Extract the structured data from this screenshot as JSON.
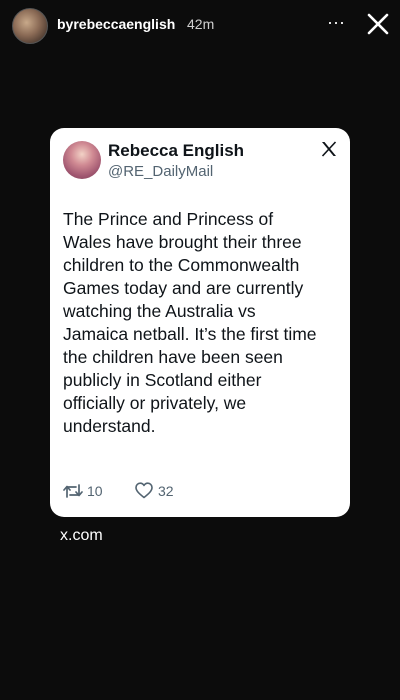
{
  "story": {
    "username": "byrebeccaenglish",
    "time": "42m",
    "more_icon": "more-horizontal-icon",
    "close_icon": "close-icon"
  },
  "tweet": {
    "author_name": "Rebecca English",
    "author_handle": "@RE_DailyMail",
    "platform_icon": "x-logo-icon",
    "text": "The Prince and Princess of\nWales have brought their three\nchildren to the Commonwealth\nGames today and are currently\nwatching the  Australia vs\nJamaica netball. It’s the first time\nthe children have been seen\npublicly in Scotland either\nofficially or privately, we\nunderstand.",
    "retweets": "10",
    "likes": "32"
  },
  "link": {
    "label": "x.com"
  },
  "colors": {
    "background": "#0c0c0c",
    "card": "#ffffff",
    "secondary_text": "#536471"
  }
}
